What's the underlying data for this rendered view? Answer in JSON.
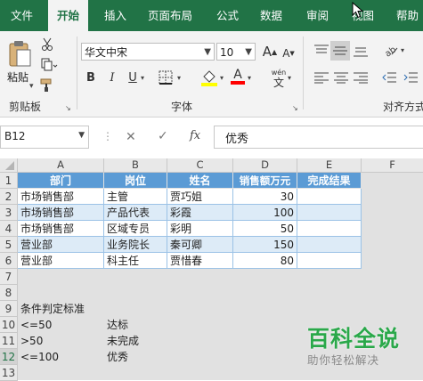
{
  "tabs": [
    {
      "label": "文件",
      "active": false
    },
    {
      "label": "开始",
      "active": true
    },
    {
      "label": "插入",
      "active": false
    },
    {
      "label": "页面布局",
      "active": false
    },
    {
      "label": "公式",
      "active": false
    },
    {
      "label": "数据",
      "active": false
    },
    {
      "label": "审阅",
      "active": false
    },
    {
      "label": "视图",
      "active": false
    },
    {
      "label": "帮助",
      "active": false
    }
  ],
  "ribbon": {
    "paste_label": "粘贴",
    "clipboard_label": "剪贴板",
    "font_name": "华文中宋",
    "font_size": "10",
    "font_label": "字体",
    "align_label": "对齐方式",
    "bold": "B",
    "italic": "I",
    "underline": "U",
    "font_grow": "A",
    "font_shrink": "A",
    "font_color_letter": "A",
    "phonetic_top": "wén",
    "phonetic_bottom": "文",
    "accent_color": "#217346",
    "fill_color": "#ffff00",
    "font_color": "#ff0000"
  },
  "formula_bar": {
    "name_box": "B12",
    "cancel": "✕",
    "enter": "✓",
    "fx": "fx",
    "value": "优秀"
  },
  "columns": [
    "A",
    "B",
    "C",
    "D",
    "E",
    "F"
  ],
  "rows": [
    "1",
    "2",
    "3",
    "4",
    "5",
    "6",
    "7",
    "8",
    "9",
    "10",
    "11",
    "12",
    "13"
  ],
  "cells": {
    "r1": [
      "部门",
      "岗位",
      "姓名",
      "销售额万元",
      "完成结果"
    ],
    "r2": [
      "市场销售部",
      "主管",
      "贾巧姐",
      "30",
      ""
    ],
    "r3": [
      "市场销售部",
      "产品代表",
      "彩霞",
      "100",
      ""
    ],
    "r4": [
      "市场销售部",
      "区域专员",
      "彩明",
      "50",
      ""
    ],
    "r5": [
      "营业部",
      "业务院长",
      "秦可卿",
      "150",
      ""
    ],
    "r6": [
      "营业部",
      "科主任",
      "贾惜春",
      "80",
      ""
    ],
    "r9": [
      "条件判定标准"
    ],
    "r10": [
      "<=50",
      "达标"
    ],
    "r11": [
      ">50",
      "未完成"
    ],
    "r12": [
      "<=100",
      "优秀"
    ]
  },
  "watermark": {
    "title": "百科全说",
    "subtitle": "助你轻松解决",
    "color": "#2aa84a"
  }
}
